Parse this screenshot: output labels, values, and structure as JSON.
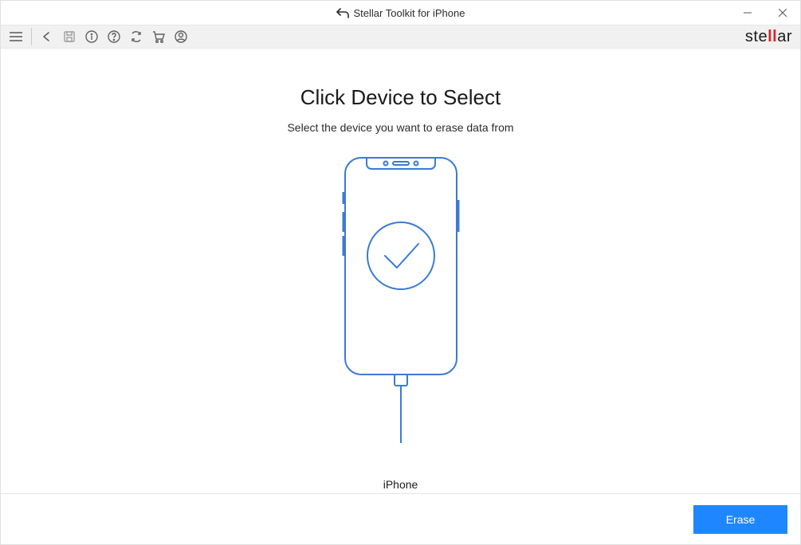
{
  "titlebar": {
    "app_title": "Stellar Toolkit for iPhone"
  },
  "brand": {
    "pre": "ste",
    "mid": "ll",
    "post": "ar"
  },
  "main": {
    "heading": "Click Device to Select",
    "subheading": "Select the device you want to erase data from",
    "device_label": "iPhone"
  },
  "footer": {
    "erase_label": "Erase"
  }
}
